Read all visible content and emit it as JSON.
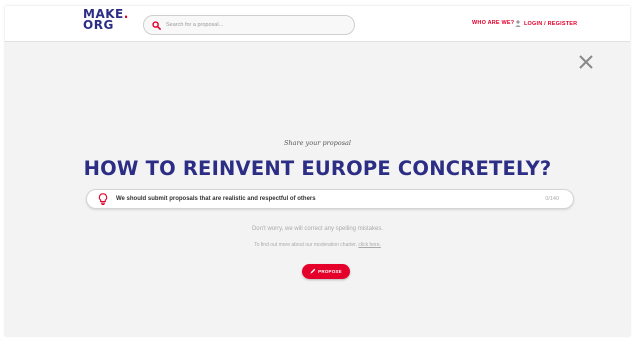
{
  "header": {
    "logo_line1": "MAKE",
    "logo_dot": ".",
    "logo_line2": "ORG",
    "search_placeholder": "Search for a proposal...",
    "who_label": "WHO ARE WE?",
    "login_label": "LOGIN / REGISTER"
  },
  "main": {
    "share_label": "Share your proposal",
    "question": "HOW TO REINVENT EUROPE CONCRETELY?",
    "proposal_text": "We should submit proposals that are realistic and respectful of others",
    "char_counter": "0/140",
    "spelling_hint": "Don't worry, we will correct any spelling mistakes.",
    "charter_prefix": "To find out more about our moderation charter,",
    "charter_link": "click here.",
    "propose_label": "PROPOSE"
  },
  "colors": {
    "brand_blue": "#2c2d84",
    "brand_red": "#e4002b"
  },
  "icons": {
    "search": "magnifier-icon",
    "user": "user-icon",
    "close": "close-icon",
    "bulb": "lightbulb-icon",
    "pencil": "pencil-icon"
  }
}
